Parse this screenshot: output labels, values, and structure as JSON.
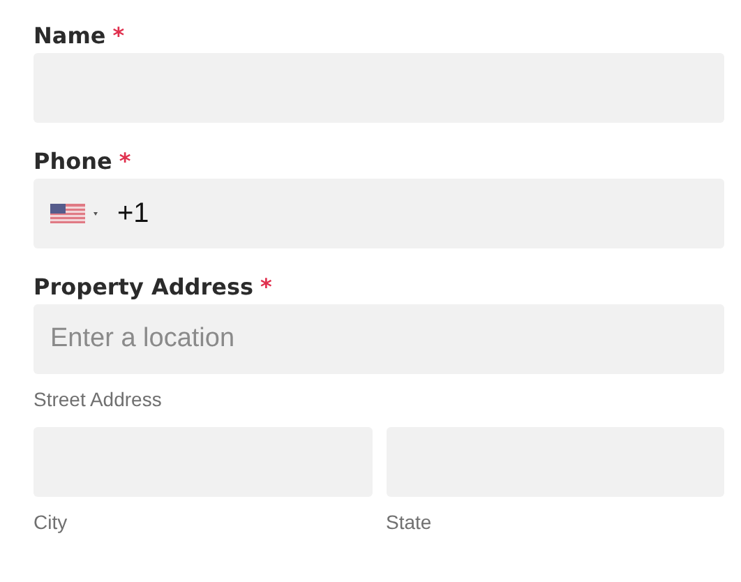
{
  "fields": [
    {
      "kind": "text",
      "label": "Name",
      "required_mark": "*"
    },
    {
      "kind": "phone",
      "label": "Phone",
      "required_mark": "*",
      "dial_code": "+1"
    },
    {
      "kind": "address",
      "label": "Property Address",
      "required_mark": "*",
      "placeholder": "Enter a location",
      "hint": "Street Address",
      "subfields": [
        {
          "hint": "City"
        },
        {
          "hint": "State"
        }
      ]
    }
  ]
}
